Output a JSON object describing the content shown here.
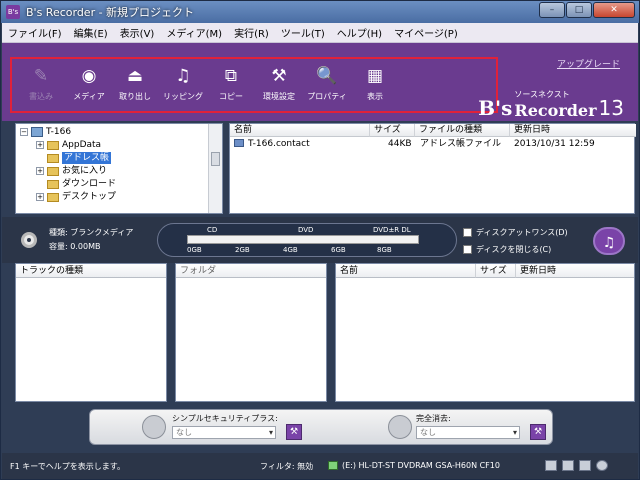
{
  "window": {
    "icon_text": "B's",
    "title": "B's Recorder - 新規プロジェクト",
    "buttons": [
      "–",
      "□",
      "✕"
    ]
  },
  "menu": [
    "ファイル(F)",
    "編集(E)",
    "表示(V)",
    "メディア(M)",
    "実行(R)",
    "ツール(T)",
    "ヘルプ(H)",
    "マイページ(P)"
  ],
  "toolbar": {
    "items": [
      {
        "label": "書込み",
        "icon": "pencil-icon",
        "glyph": "✎",
        "enabled": false
      },
      {
        "label": "メディア",
        "icon": "disc-icon",
        "glyph": "◉",
        "enabled": true
      },
      {
        "label": "取り出し",
        "icon": "eject-icon",
        "glyph": "⏏",
        "enabled": true
      },
      {
        "label": "リッピング",
        "icon": "ripping-icon",
        "glyph": "♫",
        "enabled": true
      },
      {
        "label": "コピー",
        "icon": "copy-disc-icon",
        "glyph": "⧉",
        "enabled": true
      },
      {
        "label": "環境設定",
        "icon": "settings-tools-icon",
        "glyph": "⚒",
        "enabled": true
      },
      {
        "label": "プロパティ",
        "icon": "properties-icon",
        "glyph": "🔍",
        "enabled": true
      },
      {
        "label": "表示",
        "icon": "view-icon",
        "glyph": "▦",
        "enabled": true
      }
    ],
    "upgrade": "アップグレード",
    "brand_prefix": "B's",
    "brand_small": "ソースネクスト",
    "brand_name": "Recorder",
    "brand_version": "13"
  },
  "tree": {
    "items": [
      {
        "label": "T-166",
        "kind": "pc",
        "expander": "−"
      },
      {
        "label": "AppData",
        "kind": "folder",
        "expander": "+"
      },
      {
        "label": "アドレス帳",
        "kind": "folder",
        "expander": "",
        "selected": true
      },
      {
        "label": "お気に入り",
        "kind": "folder",
        "expander": "+"
      },
      {
        "label": "ダウンロード",
        "kind": "folder",
        "expander": ""
      },
      {
        "label": "デスクトップ",
        "kind": "folder",
        "expander": "+"
      }
    ]
  },
  "files": {
    "columns": [
      "名前",
      "サイズ",
      "ファイルの種類",
      "更新日時"
    ],
    "rows": [
      {
        "name": "T-166.contact",
        "size": "44KB",
        "type": "アドレス帳ファイル",
        "date": "2013/10/31 12:59"
      }
    ]
  },
  "media": {
    "kind_label": "種類:",
    "kind_value": "ブランクメディア",
    "capacity_label": "容量:",
    "capacity_value": "0.00MB",
    "scale_top": [
      "CD",
      "DVD",
      "DVD±R DL"
    ],
    "scale_bottom": [
      "0GB",
      "2GB",
      "4GB",
      "6GB",
      "8GB"
    ],
    "disc_at_once": "ディスクアットワンス(D)",
    "close_disc": "ディスクを閉じる(C)"
  },
  "tracks": {
    "header": "トラックの種類"
  },
  "folder_pane": {
    "header": "フォルダ"
  },
  "project_files": {
    "columns": [
      "名前",
      "サイズ",
      "更新日時"
    ]
  },
  "security": {
    "simple_label": "シンプルセキュリティプラス:",
    "simple_value": "なし",
    "erase_label": "完全消去:",
    "erase_value": "なし"
  },
  "status": {
    "help": "F1 キーでヘルプを表示します。",
    "filter": "フィルタ: 無効",
    "drive": "(E:) HL-DT-ST DVDRAM GSA-H60N  CF10"
  }
}
